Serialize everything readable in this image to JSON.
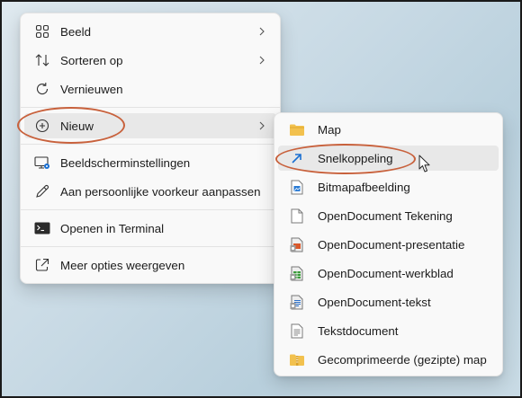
{
  "main_menu": {
    "items": [
      {
        "label": "Beeld",
        "icon": "grid-icon",
        "submenu": true
      },
      {
        "label": "Sorteren op",
        "icon": "sort-icon",
        "submenu": true
      },
      {
        "label": "Vernieuwen",
        "icon": "refresh-icon",
        "submenu": false
      },
      {
        "label": "Nieuw",
        "icon": "new-plus-icon",
        "submenu": true
      },
      {
        "label": "Beeldscherminstellingen",
        "icon": "display-settings-icon",
        "submenu": false
      },
      {
        "label": "Aan persoonlijke voorkeur aanpassen",
        "icon": "pen-icon",
        "submenu": false
      },
      {
        "label": "Openen in Terminal",
        "icon": "terminal-icon",
        "submenu": false
      },
      {
        "label": "Meer opties weergeven",
        "icon": "share-icon",
        "submenu": false
      }
    ]
  },
  "sub_menu": {
    "items": [
      {
        "label": "Map",
        "icon": "folder-icon"
      },
      {
        "label": "Snelkoppeling",
        "icon": "shortcut-icon"
      },
      {
        "label": "Bitmapafbeelding",
        "icon": "bitmap-icon"
      },
      {
        "label": "OpenDocument Tekening",
        "icon": "document-icon"
      },
      {
        "label": "OpenDocument-presentatie",
        "icon": "presentation-icon"
      },
      {
        "label": "OpenDocument-werkblad",
        "icon": "spreadsheet-icon"
      },
      {
        "label": "OpenDocument-tekst",
        "icon": "writer-icon"
      },
      {
        "label": "Tekstdocument",
        "icon": "text-document-icon"
      },
      {
        "label": "Gecomprimeerde (gezipte) map",
        "icon": "zip-folder-icon"
      }
    ]
  },
  "colors": {
    "highlight_oval": "#c8613c",
    "menu_bg": "#f9f9f9",
    "hover_bg": "#e8e8e8",
    "folder": "#f2c14e",
    "shortcut_arrow": "#1a6fd1"
  }
}
